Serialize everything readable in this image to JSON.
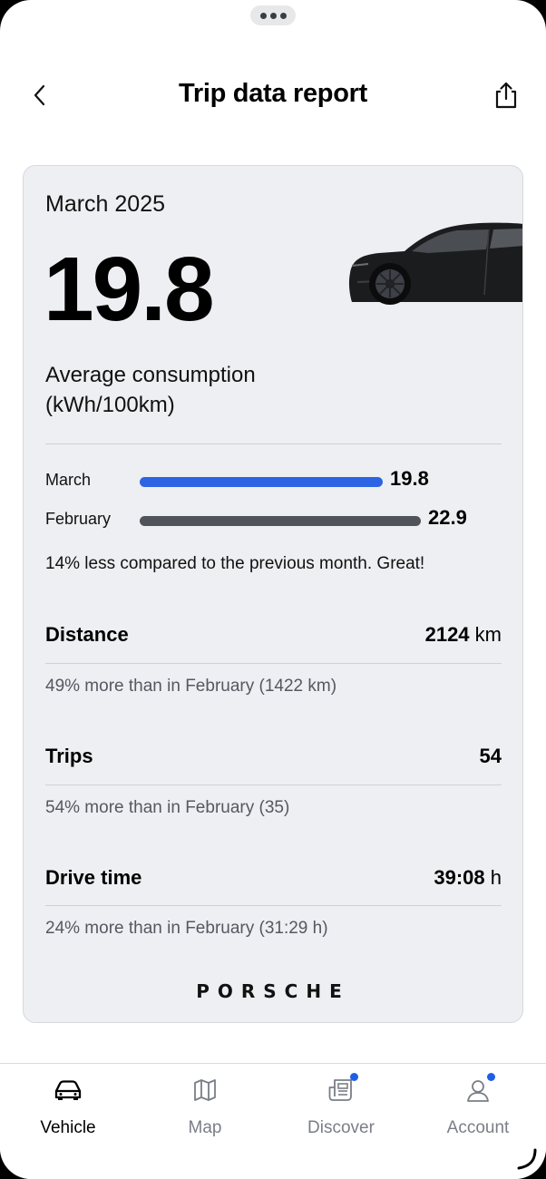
{
  "header": {
    "title": "Trip data report"
  },
  "card": {
    "month": "March 2025",
    "average_value": "19.8",
    "metric_label_line1": "Average consumption",
    "metric_label_line2": "(kWh/100km)",
    "comparison": [
      {
        "label": "March",
        "value": "19.8",
        "numeric": 19.8,
        "color": "#2c64e3"
      },
      {
        "label": "February",
        "value": "22.9",
        "numeric": 22.9,
        "color": "#50545a"
      }
    ],
    "comparison_text": "14% less compared to the previous month. Great!",
    "stats": [
      {
        "title": "Distance",
        "value": "2124",
        "unit": "km",
        "sub": "49% more than in February (1422 km)"
      },
      {
        "title": "Trips",
        "value": "54",
        "unit": "",
        "sub": "54% more than in February (35)"
      },
      {
        "title": "Drive time",
        "value": "39:08",
        "unit": "h",
        "sub": "24% more than in February (31:29 h)"
      }
    ],
    "brand": "PORSCHE"
  },
  "tabbar": {
    "tabs": [
      {
        "label": "Vehicle",
        "icon": "car-icon",
        "active": true,
        "badge": false
      },
      {
        "label": "Map",
        "icon": "map-icon",
        "active": false,
        "badge": false
      },
      {
        "label": "Discover",
        "icon": "newspaper-icon",
        "active": false,
        "badge": true
      },
      {
        "label": "Account",
        "icon": "user-icon",
        "active": false,
        "badge": true
      }
    ]
  },
  "colors": {
    "accent": "#2c64e3",
    "badge": "#1f5fe8",
    "card_bg": "#eeeff2"
  }
}
